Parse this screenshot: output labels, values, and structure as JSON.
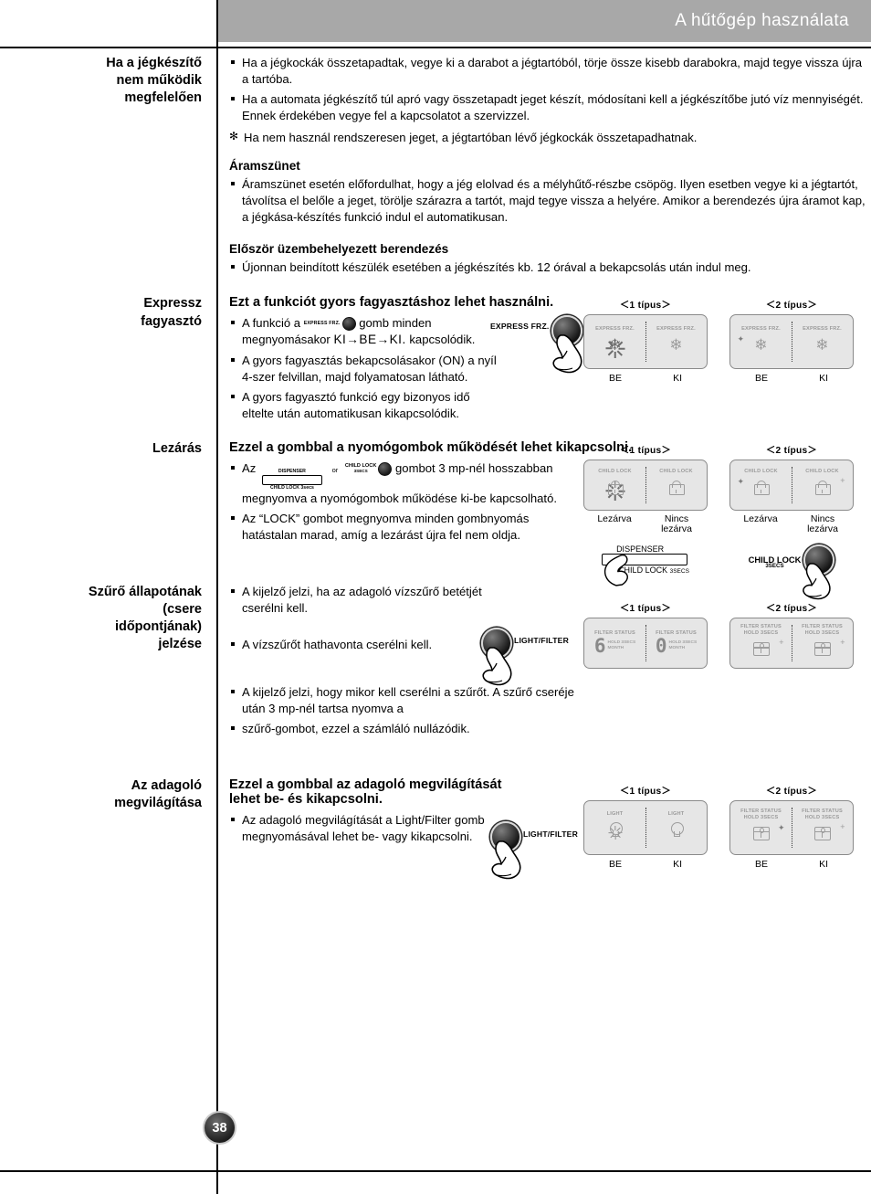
{
  "header": {
    "title": "A hűtőgép használata"
  },
  "page": {
    "number": "38"
  },
  "sections": [
    {
      "heading": "Ha a jégkészítő\nnem működik\nmegfelelően",
      "bullets": [
        "Ha a jégkockák összetapadtak, vegye ki a darabot a jégtartóból, törje össze kisebb darabokra, majd tegye vissza újra a tartóba.",
        "Ha a automata jégkészítő túl apró vagy összetapadt jeget készít, módosítani kell a jégkészítőbe jutó víz mennyiségét. Ennek érdekében vegye fel a kapcsolatot a szervizzel."
      ],
      "note": "Ha nem használ rendszeresen jeget, a jégtartóban lévő jégkockák összetapadhatnak.",
      "sub1_title": "Áramszünet",
      "sub1_bullet": "Áramszünet esetén előfordulhat, hogy a jég elolvad és a mélyhűtő-részbe csöpög. Ilyen esetben vegye ki a jégtartót, távolítsa el belőle a jeget, törölje szárazra a tartót, majd tegye vissza a helyére. Amikor a berendezés újra áramot kap, a jégkása-készítés funkció indul el automatikusan.",
      "sub2_title": "Először üzembehelyezett berendezés",
      "sub2_bullet": "Újonnan beindított készülék esetében a jégkészítés kb. 12 órával a bekapcsolás után indul meg."
    },
    {
      "heading": "Expressz\nfagyasztó",
      "lead": "Ezt a funkciót gyors fagyasztáshoz lehet használni.",
      "b1_pre": "A funkció a",
      "b1_btn": "EXPRESS FRZ.",
      "b1_mid": "gomb minden megnyomásakor",
      "b1_cycle": "KI→BE→KI.",
      "b1_post": "kapcsolódik.",
      "b2": "A gyors fagyasztás bekapcsolásakor (ON) a nyíl 4-szer felvillan, majd folyamatosan látható.",
      "b3": "A gyors fagyasztó funkció egy bizonyos idő eltelte után automatikusan kikapcsolódik.",
      "press_label": "EXPRESS FRZ.",
      "fig": {
        "type1_caption": "＜1 típus＞",
        "type2_caption": "＜2 típus＞",
        "panel_label": "EXPRESS FRZ.",
        "state_on": "BE",
        "state_off": "KI"
      }
    },
    {
      "heading": "Lezárás",
      "lead": "Ezzel a gombbal a nyomógombok működését lehet kikapcsolni.",
      "b1_pre": "Az",
      "b1_disp_top": "DISPENSER",
      "b1_disp_bottom": "CHILD LOCK",
      "b1_disp_bottom_small": "3secs",
      "b1_or": "or",
      "b1_cl_a": "CHILD LOCK",
      "b1_cl_b": "3SECS",
      "b1_post": "gombot 3 mp-nél hosszabban megnyomva a  nyomógombok működése ki-be kapcsolható.",
      "b2": "Az “LOCK” gombot megnyomva minden gombnyomás hatástalan marad, amíg a lezárást újra fel nem oldja.",
      "fig": {
        "type1_caption": "＜1 típus＞",
        "type2_caption": "＜2 típus＞",
        "panel_label": "CHILD LOCK",
        "state_locked": "Lezárva",
        "state_unlocked": "Nincs lezárva",
        "press1_top": "DISPENSER",
        "press1_bottom": "CHILD LOCK",
        "press1_bottom_small": "3SECS",
        "press2_a": "CHILD LOCK",
        "press2_b": "3SECS"
      }
    },
    {
      "heading": "Szűrő állapotának\n(csere\nidőpontjának)\njelzése",
      "b1": "A kijelző jelzi, ha az adagoló vízszűrő betétjét cserélni kell.",
      "b2": "A vízszűrőt hathavonta cserélni kell.",
      "b3": "A kijelző jelzi, hogy mikor kell cserélni a szűrőt. A szűrő cseréje után 3 mp-nél tartsa nyomva a",
      "b4": "szűrő-gombot, ezzel a számláló nullázódik.",
      "press_label": "LIGHT/FILTER",
      "fig": {
        "type1_caption": "＜1 típus＞",
        "type2_caption": "＜2 típus＞",
        "panel_label": "FILTER STATUS",
        "hold_label": "HOLD 3SECS",
        "month_label": "MONTH",
        "digit_on": "6",
        "digit_off": "0"
      }
    },
    {
      "heading": "Az adagoló\nmegvilágítása",
      "lead": "Ezzel a gombbal az adagoló megvilágítását lehet be- és kikapcsolni.",
      "b1": "Az adagoló megvilágítását a Light/Filter gomb megnyomásával lehet be- vagy kikapcsolni.",
      "press_label": "LIGHT/FILTER",
      "fig": {
        "type1_caption": "＜1 típus＞",
        "type2_caption": "＜2 típus＞",
        "panel_label_light": "LIGHT",
        "panel_label_filter": "FILTER STATUS HOLD 3SECS",
        "state_on": "BE",
        "state_off": "KI"
      }
    }
  ]
}
